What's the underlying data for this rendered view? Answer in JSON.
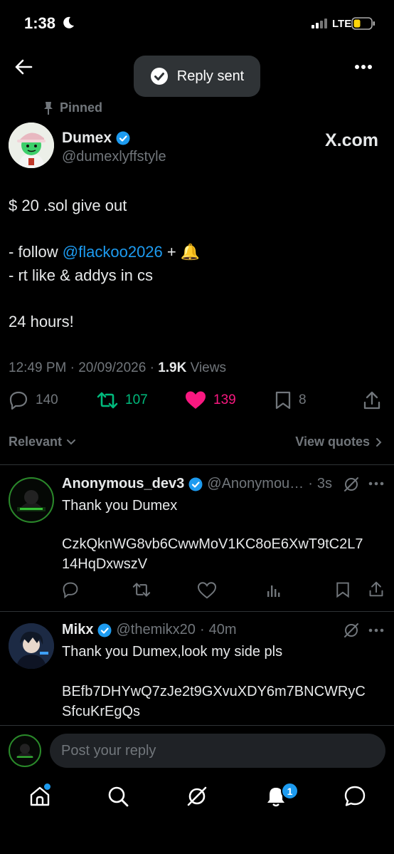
{
  "status_bar": {
    "time": "1:38",
    "network": "LTE"
  },
  "toast": {
    "text": "Reply sent"
  },
  "tweet": {
    "pinned_label": "Pinned",
    "author_name": "Dumex",
    "author_handle": "@dumexlyffstyle",
    "source": "X.com",
    "line1": "$ 20 .sol give out",
    "line2_prefix": "- follow ",
    "line2_mention": "@flackoo2026",
    "line2_suffix": " + 🔔",
    "line3": "- rt like & addys in cs",
    "line4": "24 hours!",
    "time": "12:49 PM",
    "date": "20/09/2026",
    "views_count": "1.9K",
    "views_label": "Views",
    "replies": "140",
    "retweets": "107",
    "likes": "139",
    "bookmarks": "8"
  },
  "sort": {
    "label": "Relevant",
    "view_quotes": "View quotes"
  },
  "replies": [
    {
      "name": "Anonymous_dev3",
      "handle": "@Anonymou…",
      "time": "3s",
      "line1": "Thank you Dumex",
      "line2": "CzkQknWG8vb6CwwMoV1KC8oE6XwT9tC2L7",
      "line3": "14HqDxwszV"
    },
    {
      "name": "Mikx",
      "handle": "@themikx20",
      "time": "40m",
      "line1": "Thank you Dumex,look my side pls",
      "line2": "BEfb7DHYwQ7zJe2t9GXvuXDY6m7BNCWRyC",
      "line3": "SfcuKrEgQs"
    }
  ],
  "composer": {
    "placeholder": "Post your reply"
  },
  "nav": {
    "notification_badge": "1"
  },
  "colors": {
    "accent": "#1d9bf0",
    "retweet": "#00ba7c",
    "like": "#f91880",
    "muted": "#71767b"
  }
}
